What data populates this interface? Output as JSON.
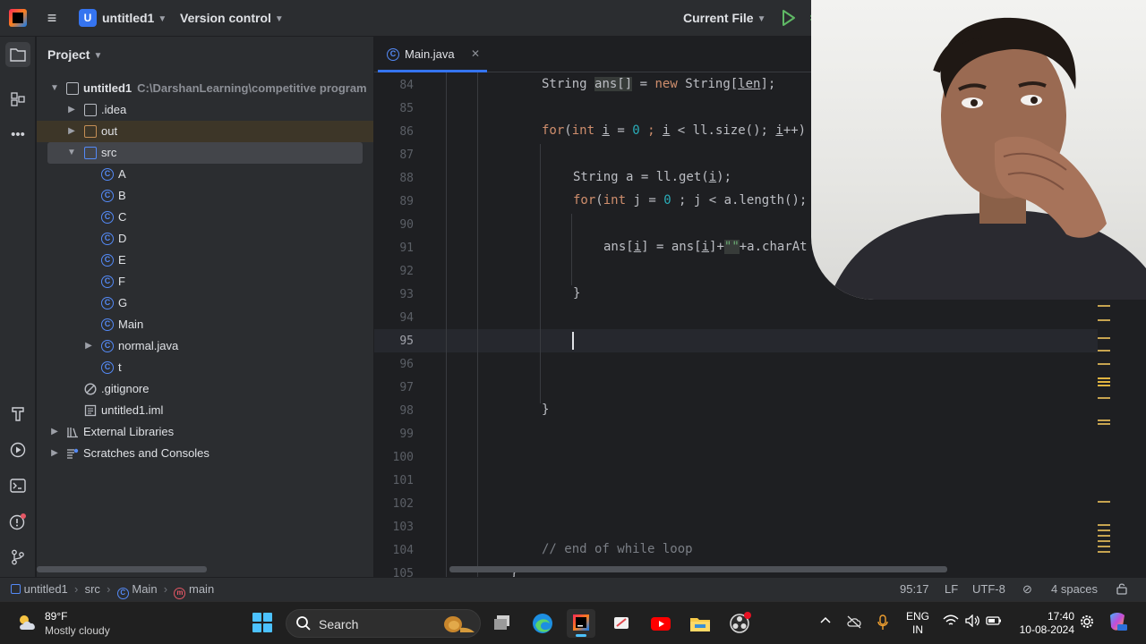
{
  "titlebar": {
    "project_badge": "U",
    "project_name": "untitled1",
    "version_control": "Version control",
    "run_config": "Current File"
  },
  "project_panel": {
    "title": "Project",
    "tree": [
      {
        "label": "untitled1",
        "path": "C:\\DarshanLearning\\competitive program"
      },
      {
        "label": ".idea"
      },
      {
        "label": "out"
      },
      {
        "label": "src"
      },
      {
        "label": "A"
      },
      {
        "label": "B"
      },
      {
        "label": "C"
      },
      {
        "label": "D"
      },
      {
        "label": "E"
      },
      {
        "label": "F"
      },
      {
        "label": "G"
      },
      {
        "label": "Main"
      },
      {
        "label": "normal.java"
      },
      {
        "label": "t"
      },
      {
        "label": ".gitignore"
      },
      {
        "label": "untitled1.iml"
      },
      {
        "label": "External Libraries"
      },
      {
        "label": "Scratches and Consoles"
      }
    ]
  },
  "editor": {
    "tab_label": "Main.java",
    "line_numbers": [
      "84",
      "85",
      "86",
      "87",
      "88",
      "89",
      "90",
      "91",
      "92",
      "93",
      "94",
      "95",
      "96",
      "97",
      "98",
      "99",
      "100",
      "101",
      "102",
      "103",
      "104",
      "105"
    ],
    "current_line": "95",
    "code": {
      "l84": {
        "a": "String ",
        "b": "ans[]",
        "c": " = ",
        "d": "new",
        "e": " String[",
        "f": "len",
        "g": "];"
      },
      "l86": {
        "a": "for",
        "b": "(",
        "c": "int",
        "d": " ",
        "e": "i",
        "f": " = ",
        "g": "0",
        "h": " ; ",
        "i": "i",
        "j": " < ll.size(); ",
        "k": "i",
        "l": "++)"
      },
      "l88": {
        "a": "String a = ll.get(",
        "b": "i",
        "c": ");"
      },
      "l89": {
        "a": "for",
        "b": "(",
        "c": "int",
        "d": " j = ",
        "e": "0",
        "f": " ; j < a.length();"
      },
      "l91": {
        "a": "ans[",
        "b": "i",
        "c": "] = ans[",
        "d": "i",
        "e": "]+",
        "f": "\"\"",
        "g": "+a.charAt"
      },
      "l93": "}",
      "l98": "}",
      "l104": "// end of while loop",
      "l105": "}"
    }
  },
  "statusbar": {
    "breadcrumb": [
      "untitled1",
      "src",
      "Main",
      "main"
    ],
    "position": "95:17",
    "line_ending": "LF",
    "encoding": "UTF-8",
    "indent": "4 spaces"
  },
  "taskbar": {
    "weather_temp": "89°F",
    "weather_desc": "Mostly cloudy",
    "search_label": "Search",
    "lang_line1": "ENG",
    "lang_line2": "IN",
    "time": "17:40",
    "date": "10-08-2024"
  },
  "icons": {
    "menu": "hamburger-icon",
    "run": "play-icon",
    "folder": "folder-icon",
    "class": "class-c-icon"
  },
  "colors": {
    "accent": "#3574f0",
    "keyword": "#cf8e6d",
    "number": "#2aacb8",
    "string": "#6aab73",
    "comment": "#7a7e85"
  }
}
